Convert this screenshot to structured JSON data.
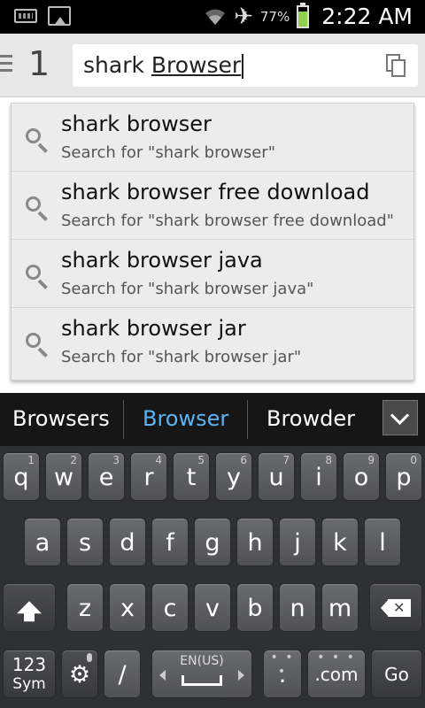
{
  "status_bar": {
    "icons": [
      "keyboard-icon",
      "image-icon",
      "wifi-icon",
      "airplane-icon",
      "battery-icon"
    ],
    "battery_percent": "77%",
    "battery_level": 0.77,
    "battery_color": "#8fd14f",
    "time": "2:22 AM"
  },
  "url_bar": {
    "tab_count": "1",
    "text_plain": "shark ",
    "text_underlined": "Browser"
  },
  "suggestions": [
    {
      "title": "shark browser",
      "subtitle": "Search for \"shark browser\""
    },
    {
      "title": "shark browser free download",
      "subtitle": "Search for \"shark browser free download\""
    },
    {
      "title": "shark browser java",
      "subtitle": "Search for \"shark browser java\""
    },
    {
      "title": "shark browser jar",
      "subtitle": "Search for \"shark browser jar\""
    }
  ],
  "keyboard": {
    "candidates": [
      "Browsers",
      "Browser",
      "Browder"
    ],
    "selected_candidate_color": "#5ab4f5",
    "row1": [
      {
        "ch": "q",
        "num": "1"
      },
      {
        "ch": "w",
        "num": "2"
      },
      {
        "ch": "e",
        "num": "3"
      },
      {
        "ch": "r",
        "num": "4"
      },
      {
        "ch": "t",
        "num": "5"
      },
      {
        "ch": "y",
        "num": "6"
      },
      {
        "ch": "u",
        "num": "7"
      },
      {
        "ch": "i",
        "num": "8"
      },
      {
        "ch": "o",
        "num": "9"
      },
      {
        "ch": "p",
        "num": "0"
      }
    ],
    "row2": [
      "a",
      "s",
      "d",
      "f",
      "g",
      "h",
      "j",
      "k",
      "l"
    ],
    "row3": [
      "z",
      "x",
      "c",
      "v",
      "b",
      "n",
      "m"
    ],
    "sym_line1": "123",
    "sym_line2": "Sym",
    "slash": "/",
    "space_label": "EN(US)",
    "period": ".",
    "dotcom": ".com",
    "go": "Go"
  }
}
